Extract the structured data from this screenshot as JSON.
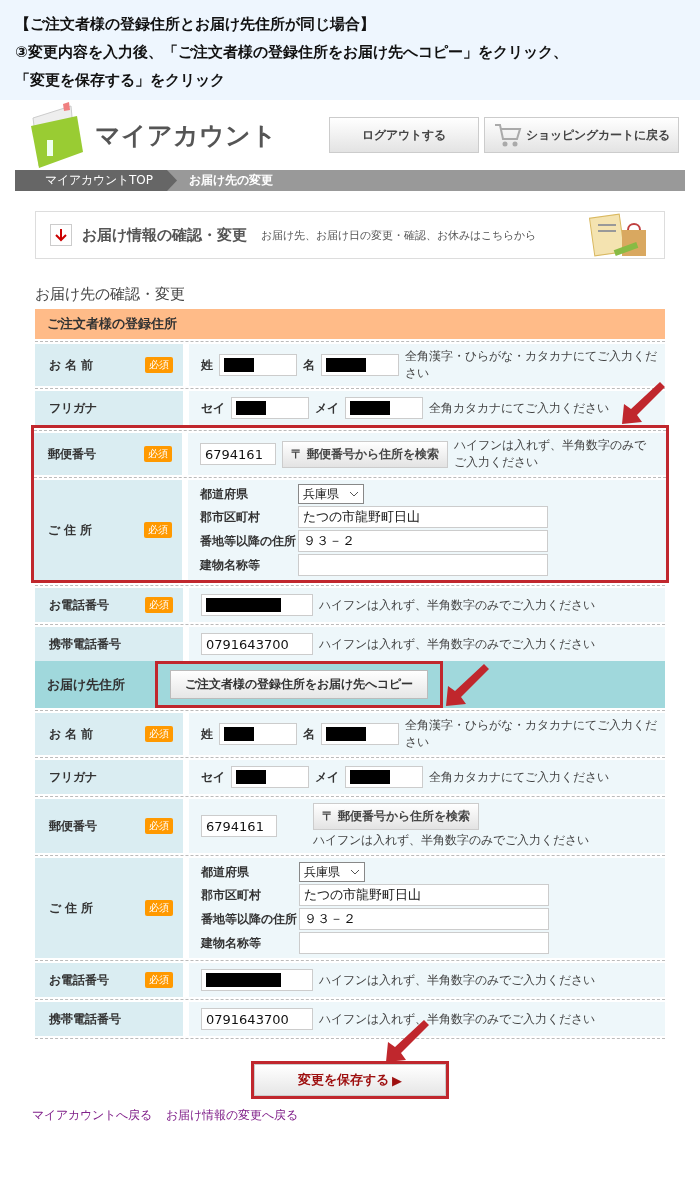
{
  "instructions": [
    "【ご注文者様の登録住所とお届け先住所が同じ場合】",
    "③変更内容を入力後、「ご注文者様の登録住所をお届け先へコピー」をクリック、",
    "「変更を保存する」をクリック"
  ],
  "logo": {
    "title": "マイアカウント"
  },
  "header_buttons": [
    {
      "label": "ログアウトする",
      "kind": "plain"
    },
    {
      "label": "ショッピングカートに戻る",
      "kind": "cart"
    }
  ],
  "breadcrumb": [
    {
      "label": "マイアカウントTOP",
      "selected": false
    },
    {
      "label": "お届け先の変更",
      "selected": true
    }
  ],
  "info_banner": {
    "title": "お届け情報の確認・変更",
    "description": "お届け先、お届け日の変更・確認、お休みはこちらから"
  },
  "page_heading": "お届け先の確認・変更",
  "sections": [
    {
      "title": "ご注文者様の登録住所",
      "color": "#ffbb88",
      "rows": [
        {
          "kind": "name",
          "label": "お 名 前",
          "badge": "必須",
          "highlighted": false,
          "fields": [
            {
              "prefix": "姓",
              "redacted": true
            },
            {
              "prefix": "名",
              "redacted": true
            }
          ],
          "hint": "全角漢字・ひらがな・カタカナにてご入力ください"
        },
        {
          "kind": "name",
          "label": "フリガナ",
          "highlighted": false,
          "fields": [
            {
              "prefix": "セイ",
              "redacted": true
            },
            {
              "prefix": "メイ",
              "redacted": true
            }
          ],
          "hint": "全角カタカナにてご入力ください"
        },
        {
          "kind": "postal",
          "label": "郵便番号",
          "badge": "必須",
          "highlighted": true,
          "value": "6794161",
          "button": "〒 郵便番号から住所を検索",
          "stacked": false,
          "hint": "ハイフンは入れず、半角数字のみでご入力ください"
        },
        {
          "kind": "address",
          "label": "ご 住 所",
          "badge": "必須",
          "highlighted": true,
          "lines": [
            {
              "label": "都道府県",
              "kind": "select",
              "value": "兵庫県"
            },
            {
              "label": "郡市区町村",
              "kind": "input",
              "value": "たつの市龍野町日山"
            },
            {
              "label": "番地等以降の住所",
              "kind": "input",
              "value": "９３－２"
            },
            {
              "label": "建物名称等",
              "kind": "input"
            }
          ]
        },
        {
          "kind": "phone",
          "label": "お電話番号",
          "badge": "必須",
          "highlighted": false,
          "redacted": true,
          "hint": "ハイフンは入れず、半角数字のみでご入力ください"
        },
        {
          "kind": "phone",
          "label": "携帯電話番号",
          "highlighted": false,
          "redacted": false,
          "value": "0791643700",
          "hint": "ハイフンは入れず、半角数字のみでご入力ください"
        }
      ]
    },
    {
      "title": "お届け先住所",
      "color": "#a0d8dc",
      "copy_button": {
        "label": "ご注文者様の登録住所をお届け先へコピー",
        "highlighted": true
      },
      "rows": [
        {
          "kind": "name",
          "label": "お 名 前",
          "badge": "必須",
          "highlighted": false,
          "fields": [
            {
              "prefix": "姓",
              "redacted": true
            },
            {
              "prefix": "名",
              "redacted": true
            }
          ],
          "hint": "全角漢字・ひらがな・カタカナにてご入力ください"
        },
        {
          "kind": "name",
          "label": "フリガナ",
          "highlighted": false,
          "fields": [
            {
              "prefix": "セイ",
              "redacted": true
            },
            {
              "prefix": "メイ",
              "redacted": true
            }
          ],
          "hint": "全角カタカナにてご入力ください"
        },
        {
          "kind": "postal",
          "label": "郵便番号",
          "badge": "必須",
          "highlighted": false,
          "value": "6794161",
          "button": "〒 郵便番号から住所を検索",
          "stacked": true,
          "hint": "ハイフンは入れず、半角数字のみでご入力ください"
        },
        {
          "kind": "address",
          "label": "ご 住 所",
          "badge": "必須",
          "highlighted": false,
          "lines": [
            {
              "label": "都道府県",
              "kind": "select",
              "value": "兵庫県"
            },
            {
              "label": "郡市区町村",
              "kind": "input",
              "value": "たつの市龍野町日山"
            },
            {
              "label": "番地等以降の住所",
              "kind": "input",
              "value": "９３－２"
            },
            {
              "label": "建物名称等",
              "kind": "input"
            }
          ]
        },
        {
          "kind": "phone",
          "label": "お電話番号",
          "badge": "必須",
          "highlighted": false,
          "redacted": true,
          "hint": "ハイフンは入れず、半角数字のみでご入力ください"
        },
        {
          "kind": "phone",
          "label": "携帯電話番号",
          "highlighted": false,
          "redacted": false,
          "value": "0791643700",
          "hint": "ハイフンは入れず、半角数字のみでご入力ください"
        }
      ]
    }
  ],
  "save_button": {
    "label": "変更を保存する",
    "arrow": "▶",
    "highlighted": true
  },
  "footer_links": [
    "マイアカウントへ戻る",
    "お届け情報の変更へ戻る"
  ]
}
